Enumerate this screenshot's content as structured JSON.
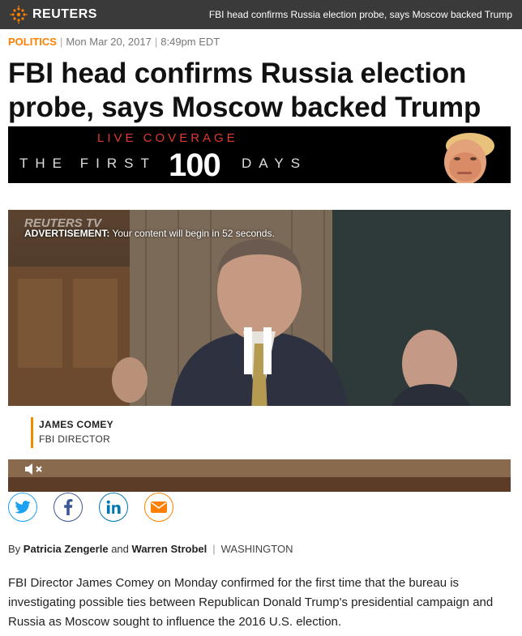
{
  "header": {
    "logo_text": "REUTERS",
    "top_headline": "FBI head confirms Russia election probe, says Moscow backed Trump",
    "brand_color": "#ff8000",
    "bar_color": "#3a3a3a"
  },
  "article": {
    "section": "POLITICS",
    "date": "Mon Mar 20, 2017",
    "time": "8:49pm EDT",
    "title": "FBI head confirms Russia election probe, says Moscow backed Trump",
    "byline_prefix": "By",
    "author1": "Patricia Zengerle",
    "and": "and",
    "author2": "Warren Strobel",
    "location": "WASHINGTON",
    "lead": "FBI Director James Comey on Monday confirmed for the first time that the bureau is investigating possible ties between Republican Donald Trump's presidential campaign and Russia as Moscow sought to influence the 2016 U.S. election."
  },
  "banner": {
    "live": "LIVE COVERAGE",
    "title": "THE FIRST",
    "number": "100",
    "days": "DAYS"
  },
  "video": {
    "watermark": "REUTERS TV",
    "ad_label": "ADVERTISEMENT:",
    "ad_message": " Your content will begin in 52 seconds.",
    "lower_third_name": "JAMES COMEY",
    "lower_third_role": "FBI DIRECTOR",
    "controls": {
      "pause_icon": "pause-icon",
      "mute_icon": "muted-speaker-icon"
    }
  },
  "share": {
    "items": [
      {
        "name": "twitter",
        "icon": "twitter-bird-icon",
        "color": "#1da1f2"
      },
      {
        "name": "facebook",
        "icon": "facebook-f-icon",
        "color": "#3b5998"
      },
      {
        "name": "linkedin",
        "icon": "linkedin-in-icon",
        "color": "#0077b5"
      },
      {
        "name": "email",
        "icon": "envelope-icon",
        "color": "#ff8000"
      }
    ]
  }
}
